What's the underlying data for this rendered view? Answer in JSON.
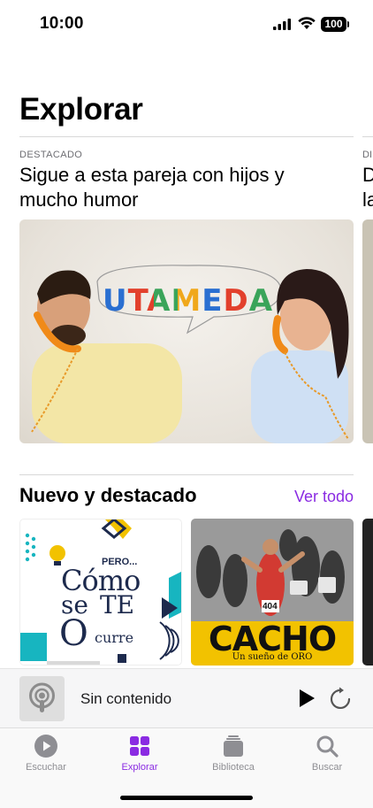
{
  "status": {
    "time": "10:00",
    "battery": "100"
  },
  "page": {
    "title": "Explorar"
  },
  "featured": {
    "overline": "DESTACADO",
    "headline": "Sigue a esta pareja con hijos y mucho humor",
    "artwork_text": "UTAMEDA",
    "peek_overline": "DI",
    "peek_headline_1": "D",
    "peek_headline_2": "la"
  },
  "section": {
    "title": "Nuevo y destacado",
    "see_all": "Ver todo"
  },
  "tiles": [
    {
      "top": "PERO...",
      "line1": "Cómo",
      "line2": "se",
      "line3": "TE",
      "line4": "O",
      "line5": "curre"
    },
    {
      "title": "CACHO",
      "subtitle": "Un sueño de ORO",
      "bib": "404"
    }
  ],
  "player": {
    "title": "Sin contenido"
  },
  "tabs": [
    {
      "label": "Escuchar",
      "icon": "play-circle-icon"
    },
    {
      "label": "Explorar",
      "icon": "grid-icon"
    },
    {
      "label": "Biblioteca",
      "icon": "library-stack-icon"
    },
    {
      "label": "Buscar",
      "icon": "search-icon"
    }
  ],
  "colors": {
    "accent": "#8a2be2",
    "tile_yellow": "#f2c200",
    "tile_teal": "#17b5c0"
  }
}
